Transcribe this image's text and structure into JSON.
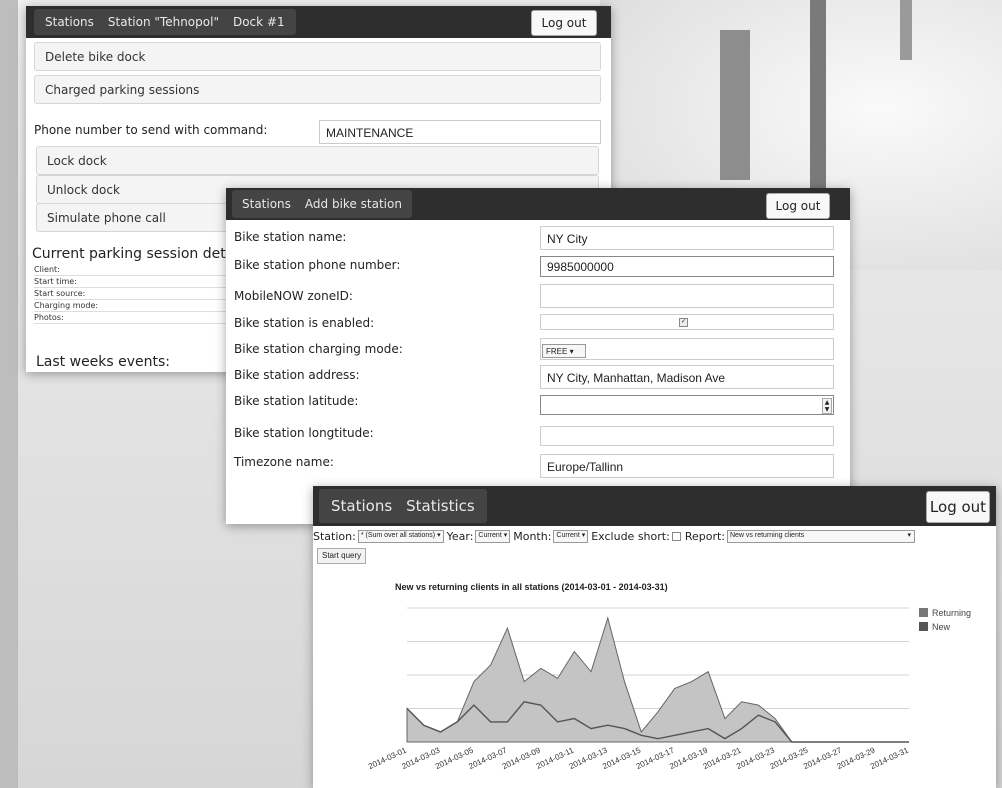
{
  "dock_window": {
    "nav": [
      "Stations",
      "Station \"Tehnopol\"",
      "Dock #1"
    ],
    "logout": "Log out",
    "actions": [
      "Delete bike dock",
      "Charged parking sessions"
    ],
    "phone_label": "Phone number to send with command:",
    "phone_value": "MAINTENANCE",
    "commands": [
      "Lock dock",
      "Unlock dock",
      "Simulate phone call"
    ],
    "session_title": "Current parking session details",
    "session_fields": [
      "Client:",
      "Start time:",
      "Start source:",
      "Charging mode:",
      "Photos:"
    ],
    "events_title": "Last weeks events:"
  },
  "station_window": {
    "nav": [
      "Stations",
      "Add bike station"
    ],
    "logout": "Log out",
    "fields": {
      "name": {
        "label": "Bike station name:",
        "value": "NY City"
      },
      "phone": {
        "label": "Bike station phone number:",
        "value": "9985000000"
      },
      "zone": {
        "label": "MobileNOW zoneID:",
        "value": ""
      },
      "enabled": {
        "label": "Bike station is enabled:",
        "checked": true
      },
      "mode": {
        "label": "Bike station charging mode:",
        "value": "FREE"
      },
      "address": {
        "label": "Bike station address:",
        "value": "NY City, Manhattan, Madison Ave"
      },
      "latitude": {
        "label": "Bike station latitude:",
        "value": ""
      },
      "longitude": {
        "label": "Bike station longtitude:",
        "value": ""
      },
      "timezone": {
        "label": "Timezone name:",
        "value": "Europe/Tallinn"
      }
    }
  },
  "stats_window": {
    "nav": [
      "Stations",
      "Statistics"
    ],
    "logout": "Log out",
    "filters": {
      "station_label": "Station:",
      "station_value": "* (Sum over all stations)",
      "year_label": "Year:",
      "year_value": "Current",
      "month_label": "Month:",
      "month_value": "Current",
      "exclude_label": "Exclude short:",
      "report_label": "Report:",
      "report_value": "New vs returning clients"
    },
    "start_query": "Start query"
  },
  "colors": {
    "navbar": "#2e2e2e",
    "returning": "#c4c4c4",
    "new": "#555555"
  },
  "chart_data": {
    "type": "area",
    "title": "New vs returning clients in all stations (2014-03-01 - 2014-03-31)",
    "xlabel": "",
    "ylabel": "",
    "legend_position": "top-right",
    "grid": true,
    "x": [
      "2014-03-01",
      "2014-03-02",
      "2014-03-03",
      "2014-03-04",
      "2014-03-05",
      "2014-03-06",
      "2014-03-07",
      "2014-03-08",
      "2014-03-09",
      "2014-03-10",
      "2014-03-11",
      "2014-03-12",
      "2014-03-13",
      "2014-03-14",
      "2014-03-15",
      "2014-03-16",
      "2014-03-17",
      "2014-03-18",
      "2014-03-19",
      "2014-03-20",
      "2014-03-21",
      "2014-03-22",
      "2014-03-23",
      "2014-03-24",
      "2014-03-25",
      "2014-03-26",
      "2014-03-27",
      "2014-03-28",
      "2014-03-29",
      "2014-03-30",
      "2014-03-31"
    ],
    "xticks": [
      "2014-03-01",
      "2014-03-03",
      "2014-03-05",
      "2014-03-07",
      "2014-03-09",
      "2014-03-11",
      "2014-03-13",
      "2014-03-15",
      "2014-03-17",
      "2014-03-19",
      "2014-03-21",
      "2014-03-23",
      "2014-03-25",
      "2014-03-27",
      "2014-03-29",
      "2014-03-31"
    ],
    "series": [
      {
        "name": "Returning",
        "values": [
          10,
          5,
          3,
          6,
          18,
          23,
          34,
          18,
          22,
          19,
          27,
          21,
          37,
          18,
          3,
          9,
          16,
          18,
          21,
          7,
          12,
          11,
          7,
          0,
          0,
          0,
          0,
          0,
          0,
          0,
          0
        ]
      },
      {
        "name": "New",
        "values": [
          10,
          5,
          3,
          6,
          11,
          6,
          6,
          12,
          11,
          6,
          7,
          4,
          5,
          4,
          2,
          1,
          2,
          3,
          4,
          1,
          4,
          8,
          6,
          0,
          0,
          0,
          0,
          0,
          0,
          0,
          0
        ]
      }
    ],
    "ylim": [
      0,
      40
    ]
  }
}
